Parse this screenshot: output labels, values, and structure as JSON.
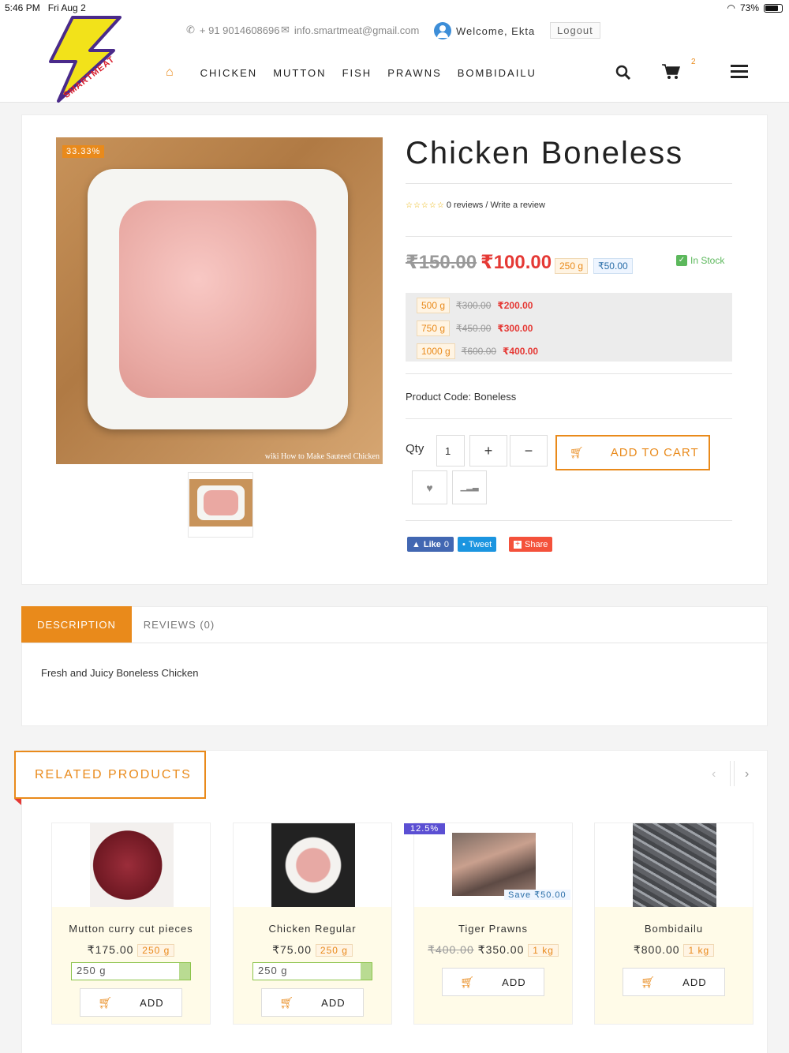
{
  "status_bar": {
    "time": "5:46 PM",
    "date": "Fri Aug 2",
    "battery": "73%"
  },
  "header": {
    "phone": "+ 91 9014608696",
    "email": "info.smartmeat@gmail.com",
    "welcome": "Welcome, Ekta",
    "logout": "Logout",
    "logo_text": "SMARTMEAT",
    "cart_count": "2",
    "nav": [
      "CHICKEN",
      "MUTTON",
      "FISH",
      "PRAWNS",
      "BOMBIDAILU"
    ]
  },
  "product": {
    "discount_badge": "33.33%",
    "image_watermark": "wiki How to Make Sauteed Chicken",
    "title": "Chicken Boneless",
    "reviews": "0 reviews / Write a review",
    "old_price": "₹150.00",
    "price": "₹100.00",
    "weight": "250 g",
    "save": "₹50.00",
    "stock": "In Stock",
    "variants": [
      {
        "weight": "500 g",
        "old": "₹300.00",
        "price": "₹200.00"
      },
      {
        "weight": "750 g",
        "old": "₹450.00",
        "price": "₹300.00"
      },
      {
        "weight": "1000 g",
        "old": "₹600.00",
        "price": "₹400.00"
      }
    ],
    "code": "Product Code: Boneless",
    "qty_label": "Qty",
    "qty_value": "1",
    "add_to_cart": "ADD TO CART",
    "social": {
      "like": "Like",
      "like_count": "0",
      "tweet": "Tweet",
      "share": "Share"
    }
  },
  "tabs": {
    "description": "DESCRIPTION",
    "reviews": "REVIEWS (0)",
    "content": "Fresh and Juicy Boneless Chicken"
  },
  "related": {
    "title": "RELATED PRODUCTS",
    "add_label": "ADD",
    "items": [
      {
        "name": "Mutton curry cut pieces",
        "price": "₹175.00",
        "weight": "250 g",
        "select": "250 g"
      },
      {
        "name": "Chicken Regular",
        "price": "₹75.00",
        "weight": "250 g",
        "select": "250 g"
      },
      {
        "name": "Tiger Prawns",
        "old": "₹400.00",
        "price": "₹350.00",
        "weight": "1 kg",
        "badge": "12.5%",
        "save": "Save ₹50.00"
      },
      {
        "name": "Bombidailu",
        "price": "₹800.00",
        "weight": "1 kg"
      }
    ]
  },
  "colors": {
    "accent": "#e98a1b",
    "price_red": "#e53935",
    "stock_green": "#5cb85c",
    "badge_purple": "#5b4fd3"
  }
}
